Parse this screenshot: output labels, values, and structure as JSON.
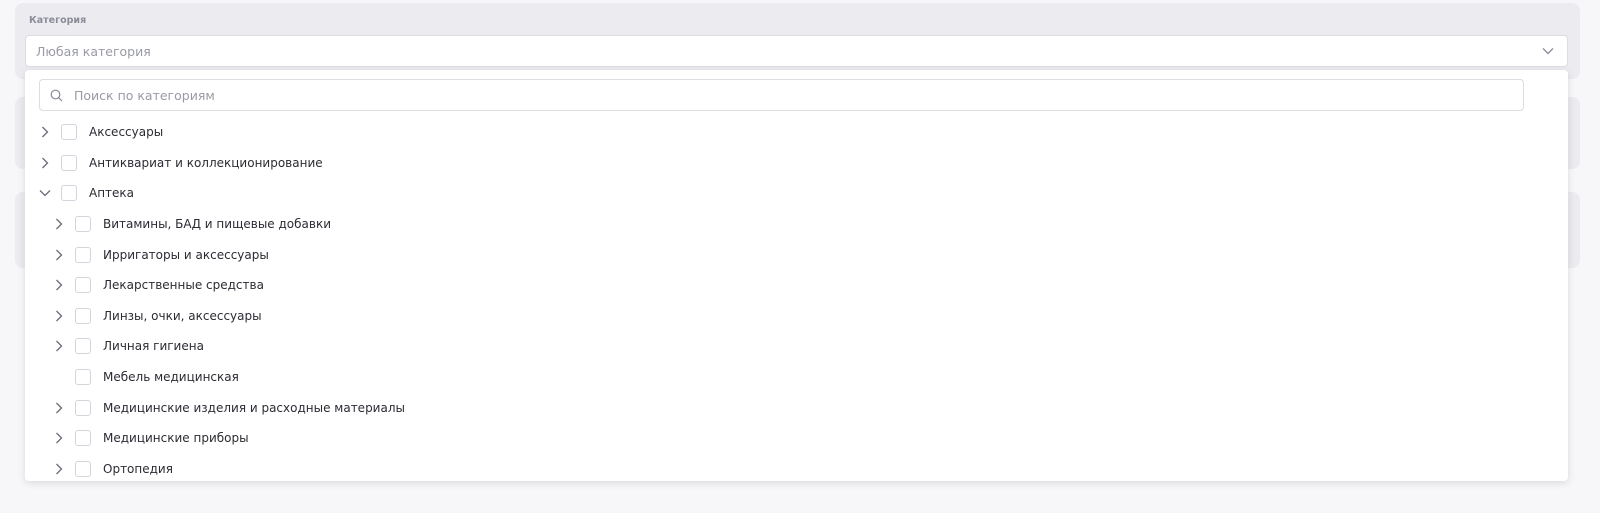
{
  "category": {
    "label": "Категория",
    "placeholder": "Любая категория",
    "search_placeholder": "Поиск по категориям"
  },
  "tree": [
    {
      "label": "Аксессуары",
      "level": 0,
      "toggle": "collapsed"
    },
    {
      "label": "Антиквариат и коллекционирование",
      "level": 0,
      "toggle": "collapsed"
    },
    {
      "label": "Аптека",
      "level": 0,
      "toggle": "expanded"
    },
    {
      "label": "Витамины, БАД и пищевые добавки",
      "level": 1,
      "toggle": "collapsed"
    },
    {
      "label": "Ирригаторы и аксессуары",
      "level": 1,
      "toggle": "collapsed"
    },
    {
      "label": "Лекарственные средства",
      "level": 1,
      "toggle": "collapsed"
    },
    {
      "label": "Линзы, очки, аксессуары",
      "level": 1,
      "toggle": "collapsed"
    },
    {
      "label": "Личная гигиена",
      "level": 1,
      "toggle": "collapsed"
    },
    {
      "label": "Мебель медицинская",
      "level": 1,
      "toggle": "none"
    },
    {
      "label": "Медицинские изделия и расходные материалы",
      "level": 1,
      "toggle": "collapsed"
    },
    {
      "label": "Медицинские приборы",
      "level": 1,
      "toggle": "collapsed"
    },
    {
      "label": "Ортопедия",
      "level": 1,
      "toggle": "collapsed"
    }
  ],
  "colors": {
    "border": "#dcdce3",
    "placeholder": "#9a9aa6",
    "text": "#2b2b33",
    "icon": "#6b6b78"
  }
}
